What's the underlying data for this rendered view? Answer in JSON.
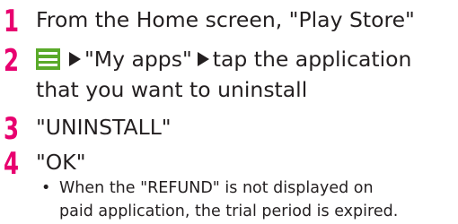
{
  "accent_color": "#e8006f",
  "menu_icon_color": "#5aaa2a",
  "steps": [
    {
      "number": "1",
      "text": "From the Home screen, \"Play Store\""
    },
    {
      "number": "2",
      "icon": "menu-icon",
      "part1": "\"My apps\"",
      "part2": "tap the application",
      "line2": "that you want to uninstall"
    },
    {
      "number": "3",
      "text": "\"UNINSTALL\""
    },
    {
      "number": "4",
      "text": "\"OK\""
    }
  ],
  "note": {
    "bullet": "•",
    "line1": "When the \"REFUND\" is not displayed on",
    "line2": "paid application, the trial period is expired."
  }
}
